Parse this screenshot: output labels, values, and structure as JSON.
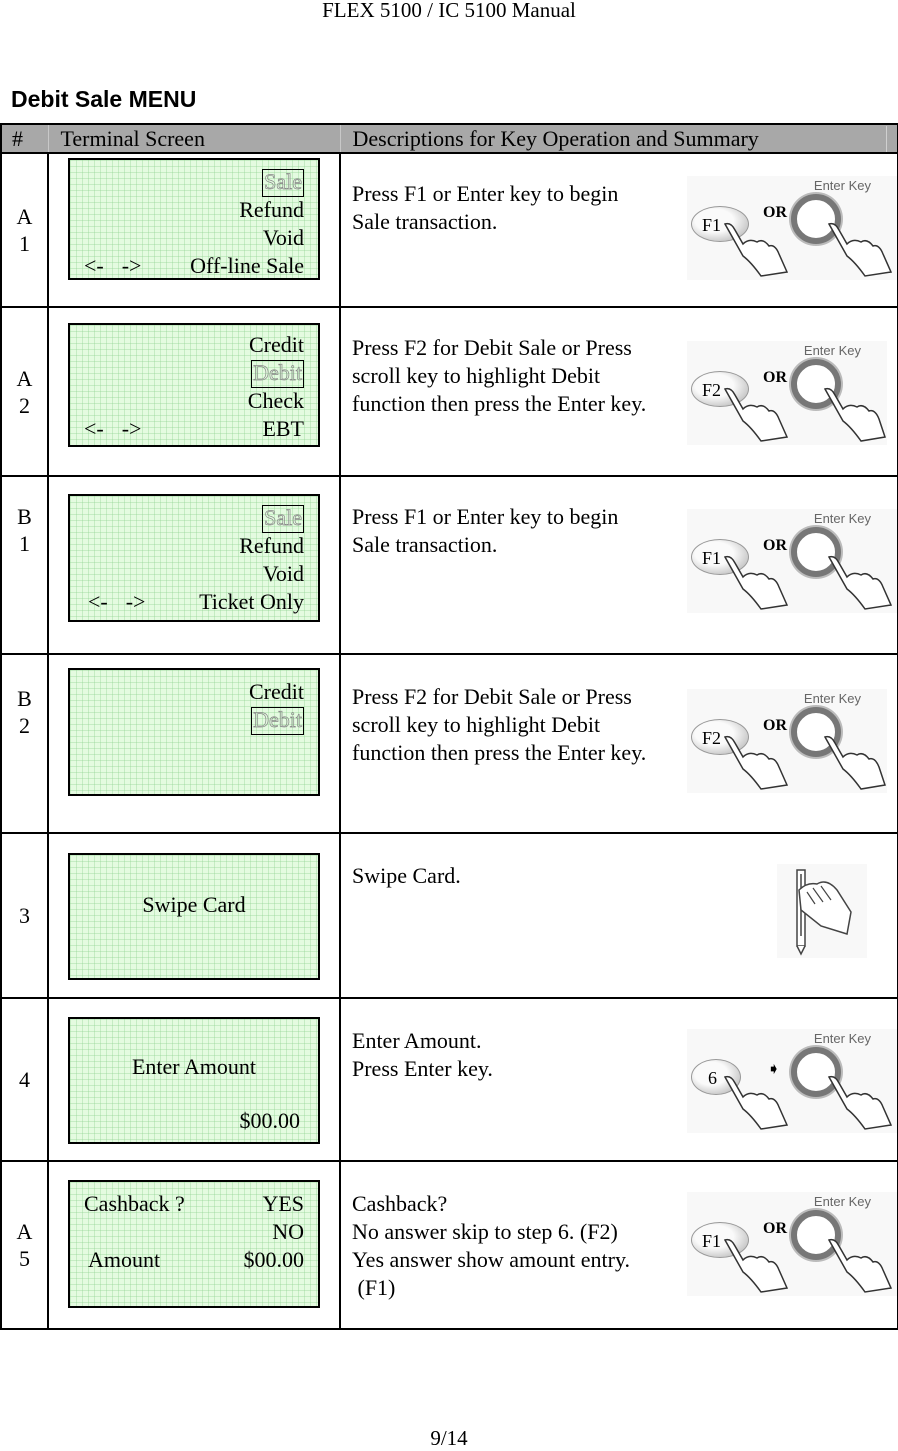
{
  "page": {
    "header": "FLEX 5100 / IC 5100 Manual",
    "section_title": "Debit Sale MENU",
    "footer": "9/14"
  },
  "table": {
    "headers": {
      "num": "#",
      "terminal": "Terminal Screen",
      "description": "Descriptions for Key Operation and Summary"
    },
    "rows": [
      {
        "num": [
          "A",
          "1"
        ],
        "screen": {
          "l1": "Sale",
          "l2": "Refund",
          "l3": "Void",
          "nav_left": "<-",
          "nav_right": "->",
          "l4": "Off-line Sale"
        },
        "description": "Press F1 or Enter key to begin\nSale transaction.",
        "keypad": {
          "key": "F1",
          "connector": "OR",
          "enter_label": "Enter Key"
        }
      },
      {
        "num": [
          "A",
          "2"
        ],
        "screen": {
          "l1": "Credit",
          "l2": "Debit",
          "l3": "Check",
          "nav_left": "<-",
          "nav_right": "->",
          "l4": "EBT"
        },
        "description": "Press F2 for Debit Sale or Press\nscroll key to highlight Debit\nfunction then press the Enter key.",
        "keypad": {
          "key": "F2",
          "connector": "OR",
          "enter_label": "Enter Key"
        }
      },
      {
        "num": [
          "B",
          "1"
        ],
        "screen": {
          "l1": "Sale",
          "l2": "Refund",
          "l3": "Void",
          "nav_left": "<-",
          "nav_right": "->",
          "l4": "Ticket Only"
        },
        "description": "Press F1 or Enter key to begin\nSale transaction.",
        "keypad": {
          "key": "F1",
          "connector": "OR",
          "enter_label": "Enter Key"
        }
      },
      {
        "num": [
          "B",
          "2"
        ],
        "screen": {
          "l1": "Credit",
          "l2": "Debit"
        },
        "description": "Press F2 for Debit Sale or Press\nscroll key to highlight Debit\nfunction then press the Enter key.",
        "keypad": {
          "key": "F2",
          "connector": "OR",
          "enter_label": "Enter Key"
        }
      },
      {
        "num": [
          "3"
        ],
        "screen": {
          "l1": "Swipe Card"
        },
        "description": "Swipe Card.",
        "picture": "card-swipe-hand-icon"
      },
      {
        "num": [
          "4"
        ],
        "screen": {
          "l1": "Enter Amount",
          "l2": "$00.00"
        },
        "description": "Enter Amount.\nPress Enter key.",
        "keypad": {
          "key": "6",
          "connector": "arrow-right",
          "enter_label": "Enter Key"
        }
      },
      {
        "num": [
          "A",
          "5"
        ],
        "screen": {
          "l1_left": "Cashback ?",
          "l1_right": "YES",
          "l2": "NO",
          "l3_left": "Amount",
          "l3_right": "$00.00"
        },
        "description": "Cashback?\nNo answer skip to step 6. (F2)\nYes answer show amount entry.\n (F1)",
        "keypad": {
          "key": "F1",
          "connector": "OR",
          "enter_label": "Enter Key"
        }
      }
    ]
  },
  "colors": {
    "header_bg": "#a8a8a8",
    "lcd_bg": "#e4fbe0",
    "lcd_grid": "#8cd28c"
  }
}
